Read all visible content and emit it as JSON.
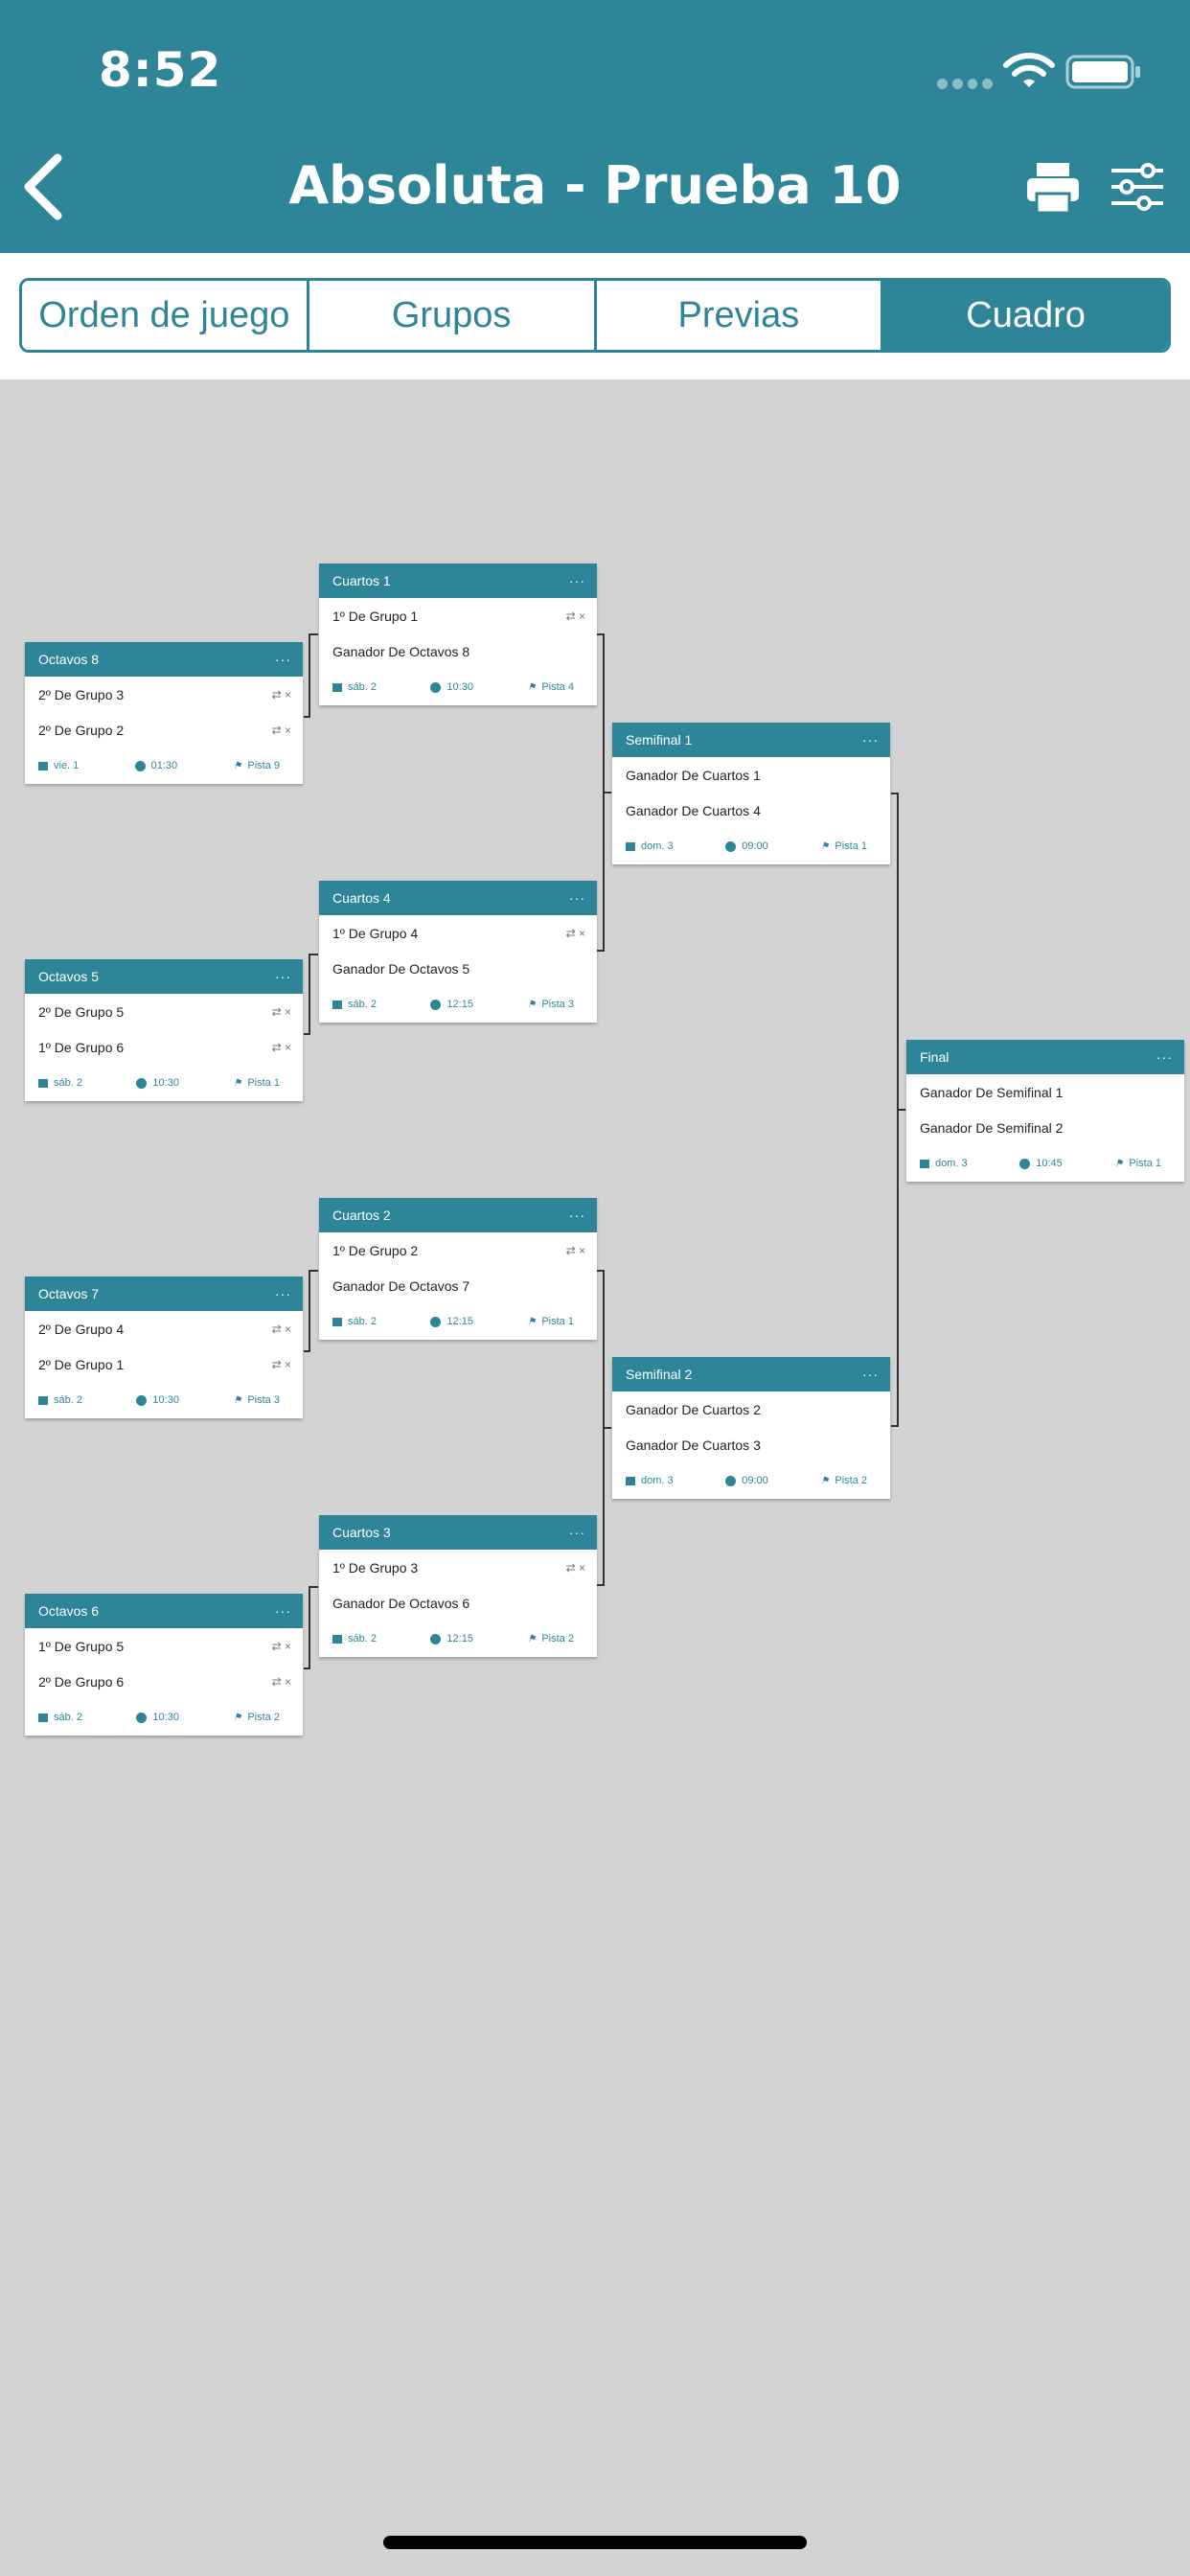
{
  "status_bar": {
    "time": "8:52"
  },
  "header": {
    "title": "Absoluta - Prueba 10"
  },
  "tabs": [
    {
      "label": "Orden de juego",
      "active": false
    },
    {
      "label": "Grupos",
      "active": false
    },
    {
      "label": "Previas",
      "active": false
    },
    {
      "label": "Cuadro",
      "active": true
    }
  ],
  "colors": {
    "accent": "#2f8598",
    "background": "#d3d3d3"
  },
  "cards": {
    "octavos8": {
      "title": "Octavos 8",
      "p1": "2º De Grupo 3",
      "p2": "2º De Grupo 2",
      "day": "vie. 1",
      "time": "01:30",
      "court": "Pista 9"
    },
    "octavos5": {
      "title": "Octavos 5",
      "p1": "2º De Grupo 5",
      "p2": "1º De Grupo 6",
      "day": "sáb. 2",
      "time": "10:30",
      "court": "Pista 1"
    },
    "octavos7": {
      "title": "Octavos 7",
      "p1": "2º De Grupo 4",
      "p2": "2º De Grupo 1",
      "day": "sáb. 2",
      "time": "10:30",
      "court": "Pista 3"
    },
    "octavos6": {
      "title": "Octavos 6",
      "p1": "1º De Grupo 5",
      "p2": "2º De Grupo 6",
      "day": "sáb. 2",
      "time": "10:30",
      "court": "Pista 2"
    },
    "cuartos1": {
      "title": "Cuartos 1",
      "p1": "1º De Grupo 1",
      "p2": "Ganador De Octavos 8",
      "day": "sáb. 2",
      "time": "10:30",
      "court": "Pista 4"
    },
    "cuartos4": {
      "title": "Cuartos 4",
      "p1": "1º De Grupo 4",
      "p2": "Ganador De Octavos 5",
      "day": "sáb. 2",
      "time": "12:15",
      "court": "Pista 3"
    },
    "cuartos2": {
      "title": "Cuartos 2",
      "p1": "1º De Grupo 2",
      "p2": "Ganador De Octavos 7",
      "day": "sáb. 2",
      "time": "12:15",
      "court": "Pista 1"
    },
    "cuartos3": {
      "title": "Cuartos 3",
      "p1": "1º De Grupo 3",
      "p2": "Ganador De Octavos 6",
      "day": "sáb. 2",
      "time": "12:15",
      "court": "Pista 2"
    },
    "semi1": {
      "title": "Semifinal 1",
      "p1": "Ganador De Cuartos 1",
      "p2": "Ganador De Cuartos 4",
      "day": "dom. 3",
      "time": "09:00",
      "court": "Pista 1"
    },
    "semi2": {
      "title": "Semifinal 2",
      "p1": "Ganador De Cuartos 2",
      "p2": "Ganador De Cuartos 3",
      "day": "dom. 3",
      "time": "09:00",
      "court": "Pista 2"
    },
    "final": {
      "title": "Final",
      "p1": "Ganador De Semifinal 1",
      "p2": "Ganador De Semifinal 2",
      "day": "dom. 3",
      "time": "10:45",
      "court": "Pista 1"
    }
  }
}
